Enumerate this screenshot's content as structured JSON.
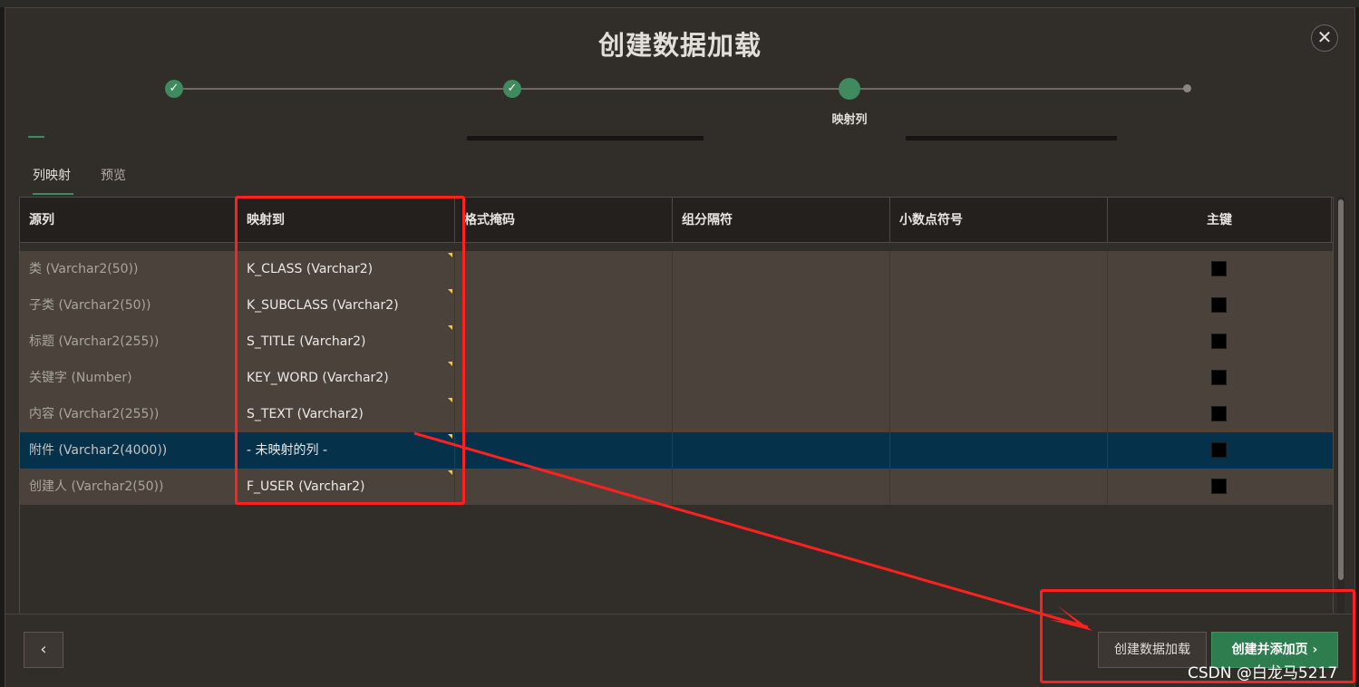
{
  "dialog": {
    "title": "创建数据加载",
    "close_glyph": "✕"
  },
  "wizard": {
    "done_glyph": "✓",
    "current_step_label": "映射列"
  },
  "tabs": [
    {
      "label": "列映射",
      "active": true
    },
    {
      "label": "预览",
      "active": false
    }
  ],
  "table": {
    "headers": [
      "源列",
      "映射到",
      "格式掩码",
      "组分隔符",
      "小数点符号",
      "主键"
    ],
    "rows": [
      {
        "source": "类 (Varchar2(50))",
        "mapped_to": "K_CLASS (Varchar2)",
        "selected": false
      },
      {
        "source": "子类 (Varchar2(50))",
        "mapped_to": "K_SUBCLASS (Varchar2)",
        "selected": false
      },
      {
        "source": "标题 (Varchar2(255))",
        "mapped_to": "S_TITLE (Varchar2)",
        "selected": false
      },
      {
        "source": "关键字 (Number)",
        "mapped_to": "KEY_WORD (Varchar2)",
        "selected": false
      },
      {
        "source": "内容 (Varchar2(255))",
        "mapped_to": "S_TEXT (Varchar2)",
        "selected": false
      },
      {
        "source": "附件 (Varchar2(4000))",
        "mapped_to": "- 未映射的列 -",
        "selected": true
      },
      {
        "source": "创建人 (Varchar2(50))",
        "mapped_to": "F_USER (Varchar2)",
        "selected": false
      }
    ]
  },
  "footer": {
    "back_glyph": "‹",
    "create_label": "创建数据加载",
    "create_add_label": "创建并添加页",
    "create_add_glyph": "›"
  },
  "watermark": "CSDN @白龙马5217",
  "colors": {
    "accent_green": "#3f8a5e",
    "primary_button": "#2e7d4f",
    "selected_row": "#05324a",
    "annotation_red": "#ff2020"
  }
}
